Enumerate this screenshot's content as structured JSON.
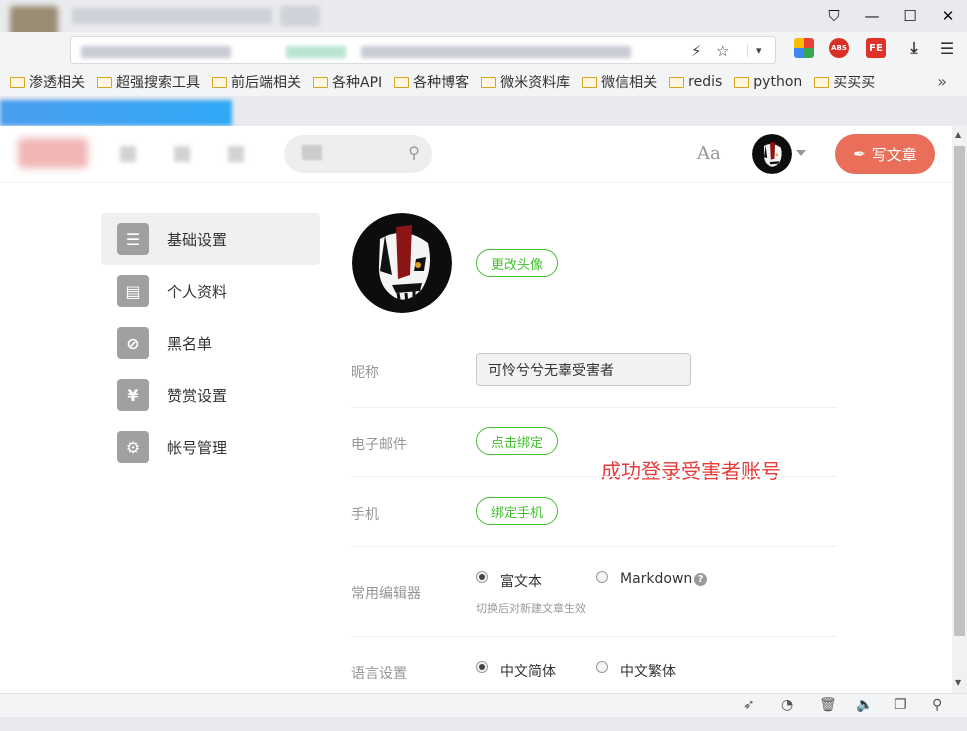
{
  "browser": {
    "window_controls": [
      "⛉",
      "—",
      "☐",
      "✕"
    ],
    "address_icons": [
      "⚡",
      "☆"
    ],
    "bookmarks": [
      "渗透相关",
      "超强搜索工具",
      "前后端相关",
      "各种API",
      "各种博客",
      "微米资料库",
      "微信相关",
      "redis",
      "python",
      "买买买"
    ],
    "more": "»",
    "extension_labels": [
      "ABS",
      "FE"
    ]
  },
  "header": {
    "font_toggle": "Aa",
    "write_button": "写文章"
  },
  "sidebar": {
    "items": [
      {
        "label": "基础设置",
        "icon": "list-icon",
        "glyph": "☰"
      },
      {
        "label": "个人资料",
        "icon": "profile-card-icon",
        "glyph": "▤"
      },
      {
        "label": "黑名单",
        "icon": "ban-icon",
        "glyph": "⊘"
      },
      {
        "label": "赞赏设置",
        "icon": "yen-icon",
        "glyph": "¥"
      },
      {
        "label": "帐号管理",
        "icon": "gear-icon",
        "glyph": "⚙"
      }
    ]
  },
  "form": {
    "change_avatar": "更改头像",
    "nickname_label": "昵称",
    "nickname_value": "可怜兮兮无辜受害者",
    "email_label": "电子邮件",
    "email_button": "点击绑定",
    "phone_label": "手机",
    "phone_button": "绑定手机",
    "editor_label": "常用编辑器",
    "editor_options": [
      "富文本",
      "Markdown"
    ],
    "editor_selected": "富文本",
    "editor_hint": "切换后对新建文章生效",
    "language_label": "语言设置",
    "language_options": [
      "中文简体",
      "中文繁体"
    ],
    "language_selected": "中文简体"
  },
  "annotation": "成功登录受害者账号",
  "colors": {
    "accent_green": "#42c02e",
    "write_button": "#ea6f5a",
    "annotation_red": "#e53b3b"
  }
}
